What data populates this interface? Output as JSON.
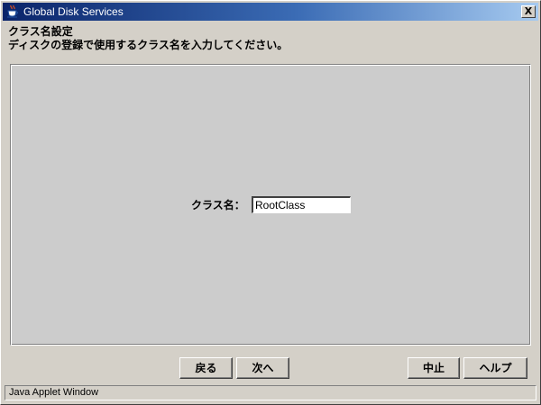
{
  "window": {
    "title": "Global Disk Services",
    "close_label": "X",
    "app_icon": "java-coffee-cup-icon",
    "title_bar_color": "#0a246a"
  },
  "header": {
    "heading": "クラス名設定",
    "instruction": "ディスクの登録で使用するクラス名を入力してください。"
  },
  "form": {
    "class_name_label": "クラス名：",
    "class_name_value": "RootClass"
  },
  "buttons": {
    "back": "戻る",
    "next": "次へ",
    "cancel": "中止",
    "help": "ヘルプ"
  },
  "status": {
    "text": "Java Applet Window"
  }
}
